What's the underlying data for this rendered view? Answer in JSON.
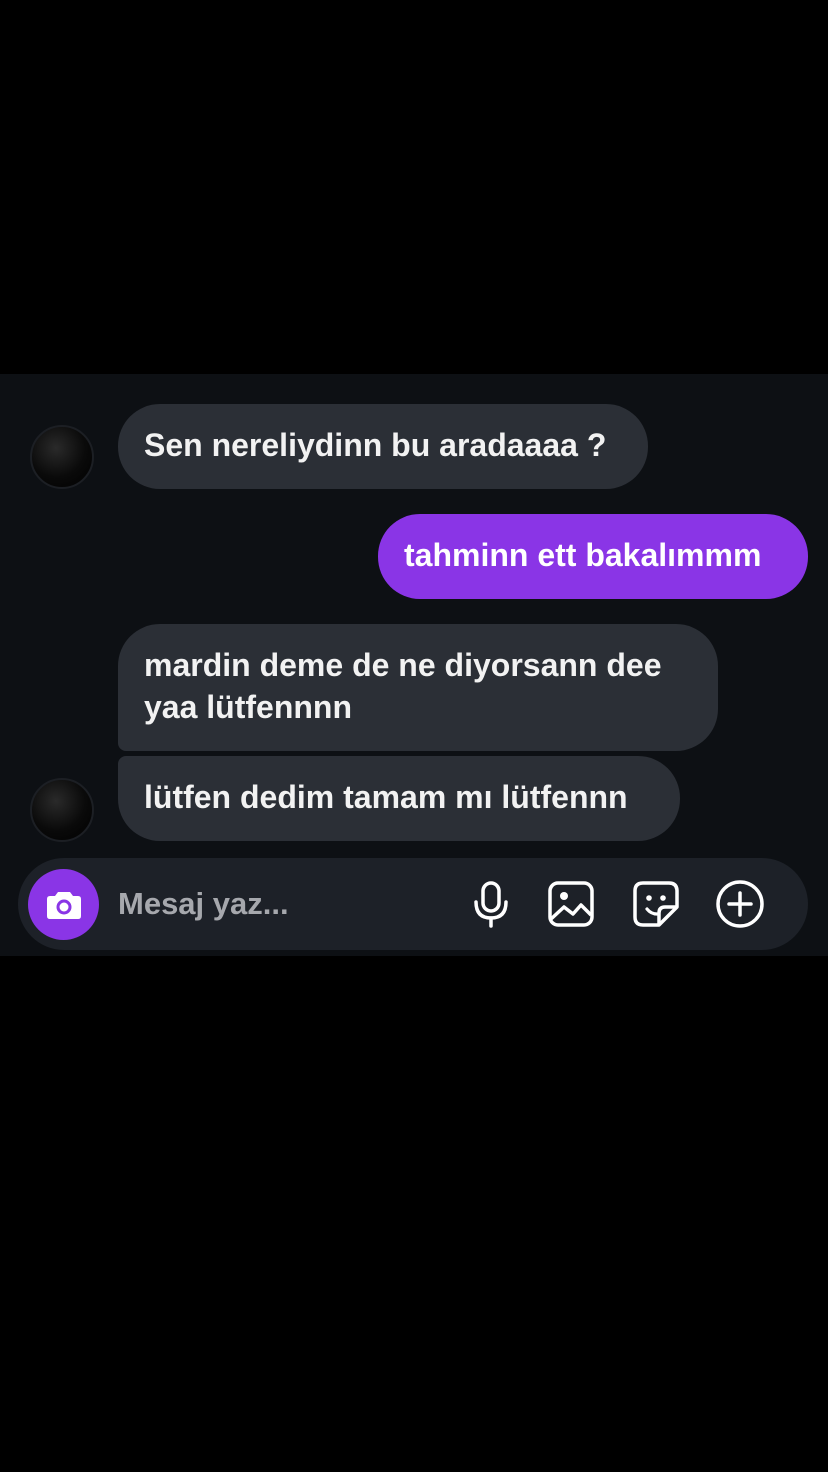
{
  "messages": [
    {
      "side": "incoming",
      "text": "Sen nereliydinn bu aradaaaa ?"
    },
    {
      "side": "outgoing",
      "text": "tahminn ett bakalımmm"
    },
    {
      "side": "incoming",
      "line1": "mardin deme de ne diyorsann dee",
      "line2": "yaa lütfennnn"
    },
    {
      "side": "incoming",
      "text": "lütfen dedim tamam mı lütfennn"
    }
  ],
  "composer": {
    "placeholder": "Mesaj yaz...",
    "value": ""
  },
  "icons": {
    "camera": "camera-icon",
    "mic": "microphone-icon",
    "gallery": "image-icon",
    "sticker": "sticker-icon",
    "add": "plus-circle-icon"
  },
  "colors": {
    "accent": "#8a35e6",
    "panel_background": "#0d1014",
    "incoming_bubble": "#2b2f36",
    "composer_background": "#1d2128",
    "page_background": "#000000"
  }
}
